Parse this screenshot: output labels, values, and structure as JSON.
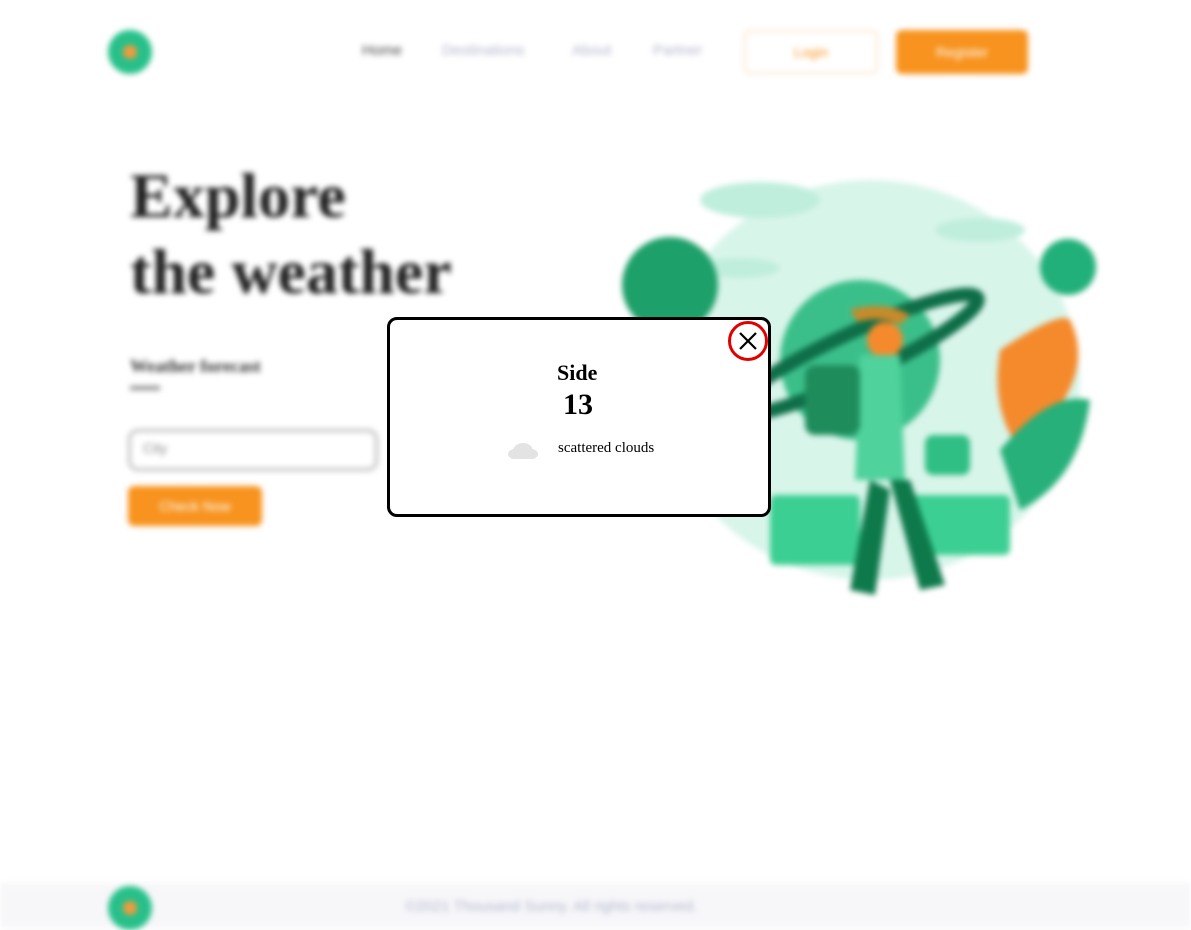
{
  "header": {
    "nav": [
      "Home",
      "Destinations",
      "About",
      "Partner"
    ],
    "login_label": "Login",
    "register_label": "Register"
  },
  "hero": {
    "title_line1": "Explore",
    "title_line2": "the weather",
    "subtitle": "Weather forecast",
    "input_placeholder": "City",
    "check_button": "Check Now"
  },
  "modal": {
    "city": "Side",
    "temperature": "13",
    "description": "scattered clouds",
    "weather_icon": "cloud-icon",
    "close_icon": "close-icon"
  },
  "footer": {
    "copyright": "©2021 Thousand Sunny. All rights reserved."
  },
  "colors": {
    "accent": "#f7931e",
    "brand_green": "#27c08a",
    "close_ring": "#e00000"
  }
}
